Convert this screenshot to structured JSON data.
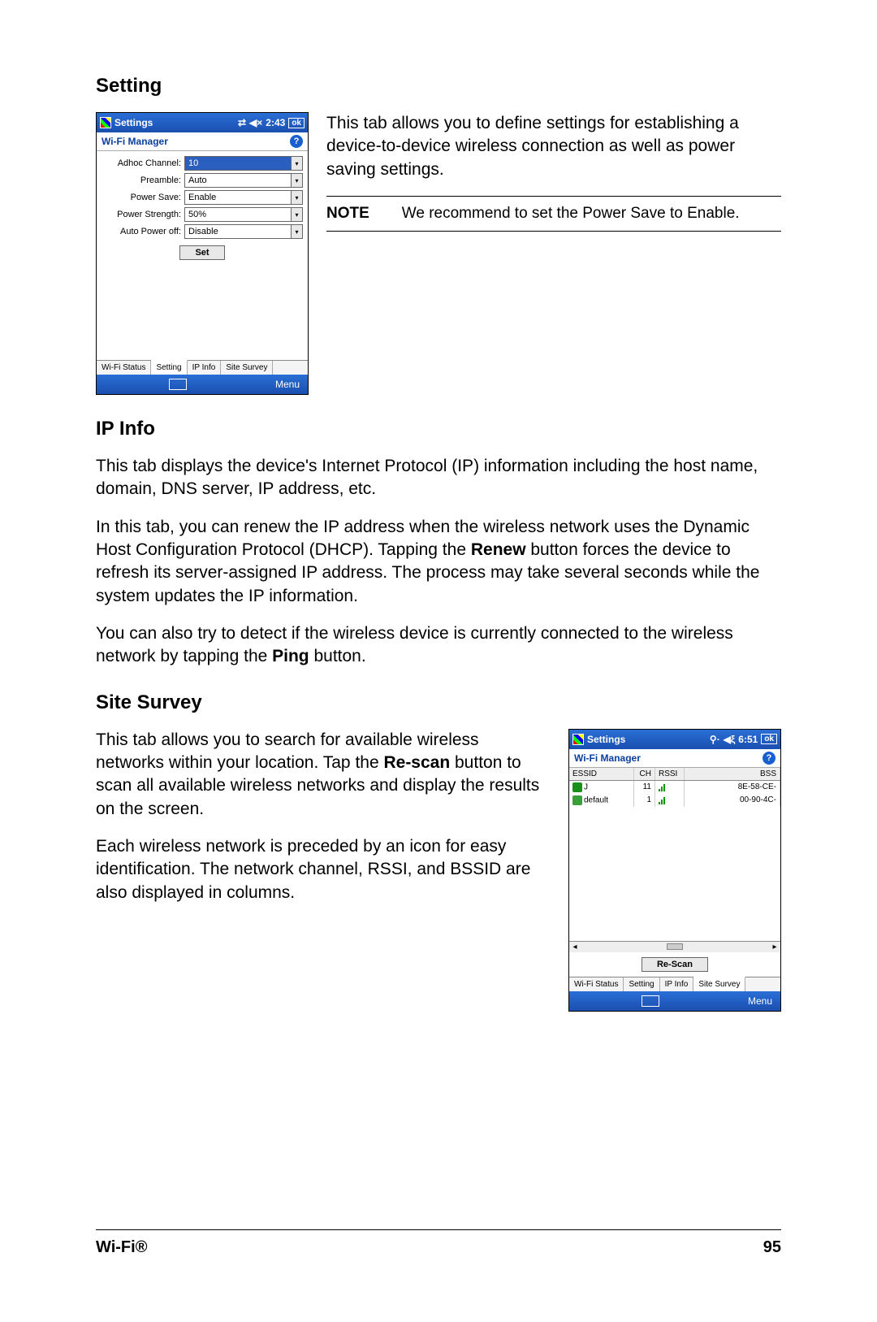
{
  "headings": {
    "setting": "Setting",
    "ipinfo": "IP Info",
    "sitesurvey": "Site Survey"
  },
  "setting_screenshot": {
    "titlebar": {
      "title": "Settings",
      "time": "2:43",
      "ok": "ok"
    },
    "subtitle": "Wi-Fi Manager",
    "fields": {
      "adhoc": {
        "label": "Adhoc Channel:",
        "value": "10"
      },
      "preamble": {
        "label": "Preamble:",
        "value": "Auto"
      },
      "powersave": {
        "label": "Power Save:",
        "value": "Enable"
      },
      "powerstrength": {
        "label": "Power Strength:",
        "value": "50%"
      },
      "autopoweroff": {
        "label": "Auto Power off:",
        "value": "Disable"
      }
    },
    "set_button": "Set",
    "tabs": [
      "Wi-Fi Status",
      "Setting",
      "IP Info",
      "Site Survey"
    ],
    "menu": "Menu"
  },
  "setting_desc": "This tab allows you to define settings for establishing a device-to-device wireless connection as well as power saving settings.",
  "note": {
    "label": "NOTE",
    "text": "We recommend to set the Power Save to  Enable."
  },
  "ipinfo_p1": "This tab displays the device's Internet Protocol (IP) information including the host name, domain, DNS server, IP address, etc.",
  "ipinfo_p2a": "In this tab, you can renew the IP address when the wireless network uses the Dynamic Host Configuration Protocol (DHCP). Tapping the ",
  "ipinfo_p2b": "Renew",
  "ipinfo_p2c": " button forces the device to refresh its server-assigned IP address. The process may take several seconds while the system updates the IP information.",
  "ipinfo_p3a": "You can also try to detect if the wireless device is currently connected to the wireless network by tapping the ",
  "ipinfo_p3b": "Ping",
  "ipinfo_p3c": " button.",
  "sitesurvey_p1a": "This tab allows you to search for available wireless networks within your location. Tap the ",
  "sitesurvey_p1b": "Re-scan",
  "sitesurvey_p1c": " button to scan all available wireless networks and display the results on the screen.",
  "sitesurvey_p2": "Each wireless network is preceded by an icon for easy identification. The network channel, RSSI, and BSSID are also displayed in columns.",
  "sitesurvey_screenshot": {
    "titlebar": {
      "title": "Settings",
      "time": "6:51",
      "ok": "ok"
    },
    "subtitle": "Wi-Fi Manager",
    "columns": {
      "essid": "ESSID",
      "ch": "CH",
      "rssi": "RSSI",
      "bss": "BSS"
    },
    "rows": [
      {
        "essid": "J",
        "ch": "11",
        "bss": "8E-58-CE-"
      },
      {
        "essid": "default",
        "ch": "1",
        "bss": "00-90-4C-"
      }
    ],
    "rescan": "Re-Scan",
    "tabs": [
      "Wi-Fi Status",
      "Setting",
      "IP Info",
      "Site Survey"
    ],
    "menu": "Menu"
  },
  "footer": {
    "left": "Wi-Fi®",
    "right": "95"
  }
}
